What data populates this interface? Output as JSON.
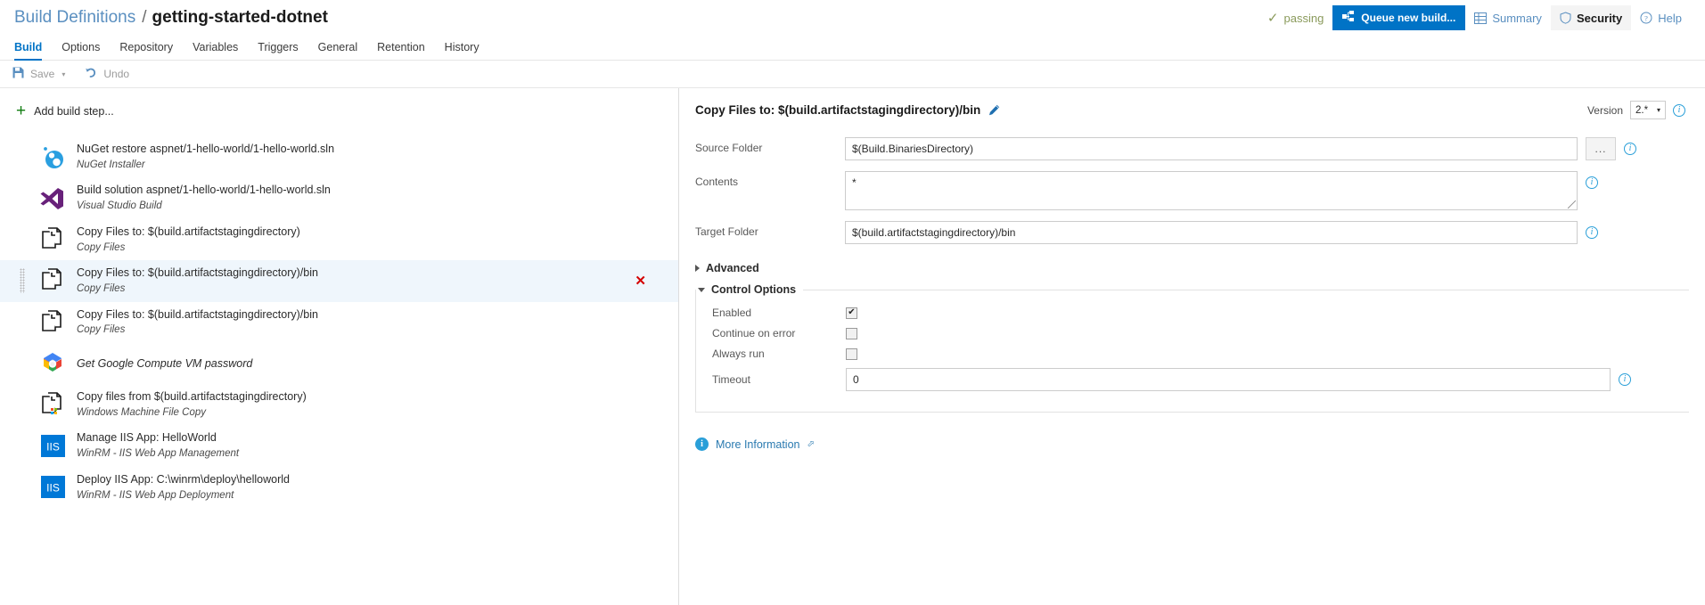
{
  "header": {
    "breadcrumb_parent": "Build Definitions",
    "breadcrumb_sep": "/",
    "breadcrumb_current": "getting-started-dotnet",
    "status_text": "passing",
    "queue_button": "Queue new build...",
    "summary_button": "Summary",
    "security_button": "Security",
    "help_button": "Help",
    "accent_color": "#0073c6",
    "status_color": "#8a9a5b"
  },
  "tabs": [
    {
      "label": "Build",
      "active": true
    },
    {
      "label": "Options",
      "active": false
    },
    {
      "label": "Repository",
      "active": false
    },
    {
      "label": "Variables",
      "active": false
    },
    {
      "label": "Triggers",
      "active": false
    },
    {
      "label": "General",
      "active": false
    },
    {
      "label": "Retention",
      "active": false
    },
    {
      "label": "History",
      "active": false
    }
  ],
  "commandbar": {
    "save_label": "Save",
    "save_caret": "▾",
    "undo_label": "Undo"
  },
  "left": {
    "add_step_label": "Add build step...",
    "steps": [
      {
        "title": "NuGet restore aspnet/1-hello-world/1-hello-world.sln",
        "subtitle": "NuGet Installer",
        "icon": "nuget-icon",
        "selected": false,
        "title_italic": false
      },
      {
        "title": "Build solution aspnet/1-hello-world/1-hello-world.sln",
        "subtitle": "Visual Studio Build",
        "icon": "visual-studio-icon",
        "selected": false,
        "title_italic": false
      },
      {
        "title": "Copy Files to: $(build.artifactstagingdirectory)",
        "subtitle": "Copy Files",
        "icon": "copy-files-icon",
        "selected": false,
        "title_italic": false
      },
      {
        "title": "Copy Files to: $(build.artifactstagingdirectory)/bin",
        "subtitle": "Copy Files",
        "icon": "copy-files-icon",
        "selected": true,
        "title_italic": false
      },
      {
        "title": "Copy Files to: $(build.artifactstagingdirectory)/bin",
        "subtitle": "Copy Files",
        "icon": "copy-files-icon",
        "selected": false,
        "title_italic": false
      },
      {
        "title": "Get Google Compute VM password",
        "subtitle": "",
        "icon": "google-cloud-icon",
        "selected": false,
        "title_italic": true
      },
      {
        "title": "Copy files from $(build.artifactstagingdirectory)",
        "subtitle": "Windows Machine File Copy",
        "icon": "windows-file-copy-icon",
        "selected": false,
        "title_italic": false
      },
      {
        "title": "Manage IIS App: HelloWorld",
        "subtitle": "WinRM - IIS Web App Management",
        "icon": "iis-icon",
        "selected": false,
        "title_italic": false
      },
      {
        "title": "Deploy IIS App: C:\\winrm\\deploy\\helloworld",
        "subtitle": "WinRM - IIS Web App Deployment",
        "icon": "iis-icon",
        "selected": false,
        "title_italic": false
      }
    ],
    "delete_glyph": "✕"
  },
  "right": {
    "title": "Copy Files to: $(build.artifactstagingdirectory)/bin",
    "version_label": "Version",
    "version_value": "2.*",
    "version_caret": "▾",
    "fields": [
      {
        "label": "Source Folder",
        "value": "$(Build.BinariesDirectory)",
        "type": "text",
        "has_browse": true
      },
      {
        "label": "Contents",
        "value": "*",
        "type": "textarea",
        "has_browse": false
      },
      {
        "label": "Target Folder",
        "value": "$(build.artifactstagingdirectory)/bin",
        "type": "text",
        "has_browse": false
      }
    ],
    "browse_label": "...",
    "advanced_label": "Advanced",
    "control_options_label": "Control Options",
    "control_options": [
      {
        "label": "Enabled",
        "checked": true
      },
      {
        "label": "Continue on error",
        "checked": false
      },
      {
        "label": "Always run",
        "checked": false
      }
    ],
    "timeout_label": "Timeout",
    "timeout_value": "0",
    "more_information_label": "More Information",
    "checkmark_glyph": "✔"
  }
}
